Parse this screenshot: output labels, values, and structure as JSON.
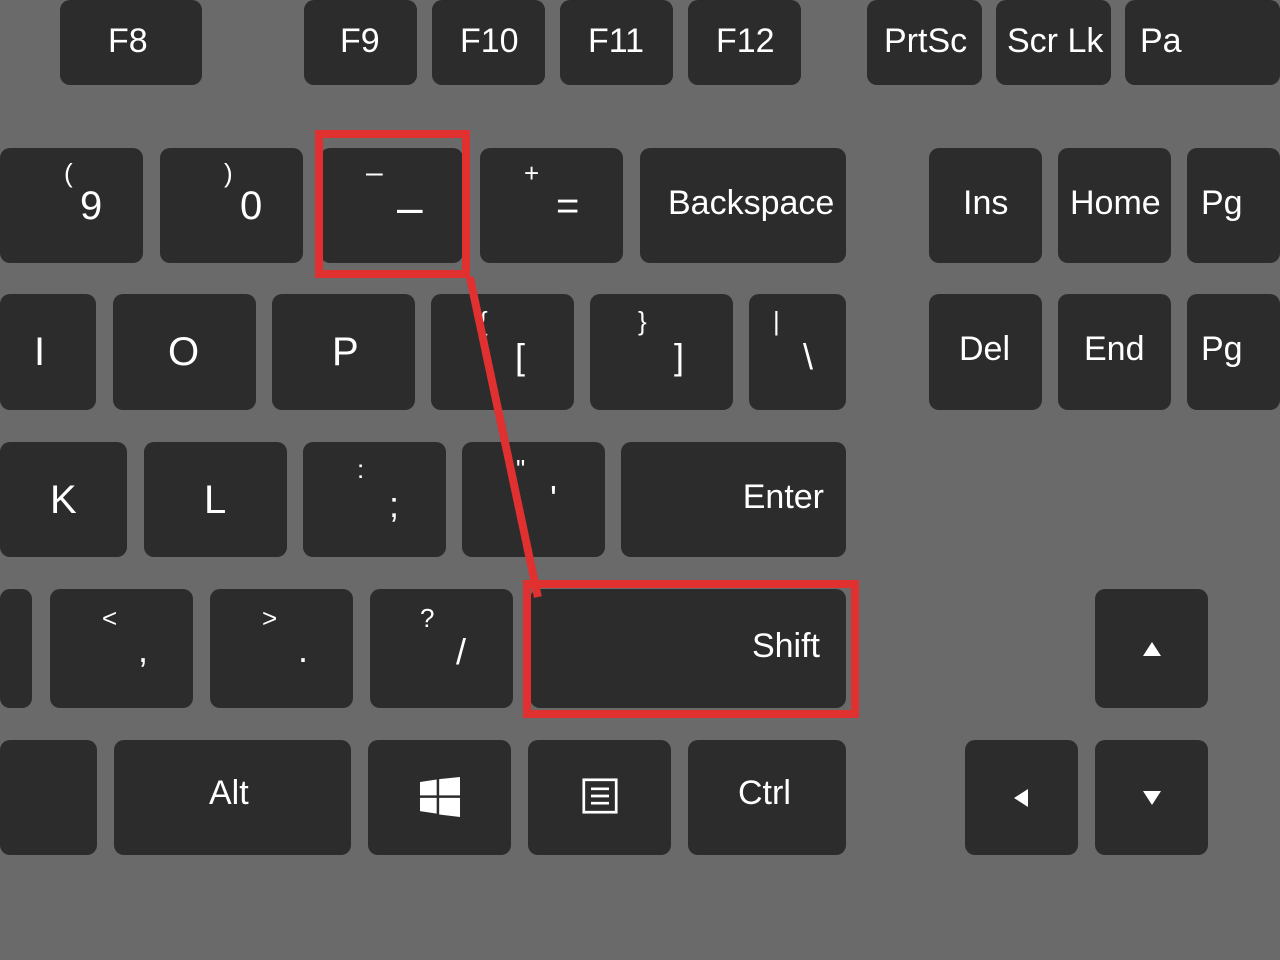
{
  "row_fn": {
    "f8": "F8",
    "f9": "F9",
    "f10": "F10",
    "f11": "F11",
    "f12": "F12",
    "prtsc": "PrtSc",
    "scrlk": "Scr Lk",
    "pa": "Pa"
  },
  "row_num": {
    "k9_upper": "(",
    "k9_lower": "9",
    "k0_upper": ")",
    "k0_lower": "0",
    "minus_upper": "–",
    "minus_lower": "–",
    "eq_upper": "+",
    "eq_lower": "=",
    "backspace": "Backspace",
    "ins": "Ins",
    "home": "Home",
    "pg": "Pg"
  },
  "row_qwer": {
    "i": "I",
    "o": "O",
    "p": "P",
    "lb_upper": "{",
    "lb_lower": "[",
    "rb_upper": "}",
    "rb_lower": "]",
    "bs_upper": "|",
    "bs_lower": "\\",
    "del": "Del",
    "end": "End",
    "pg": "Pg"
  },
  "row_asdf": {
    "k": "K",
    "l": "L",
    "semi_upper": ":",
    "semi_lower": ";",
    "quote_upper": "\"",
    "quote_lower": "'",
    "enter": "Enter"
  },
  "row_zxcv": {
    "m": "",
    "comma_upper": "<",
    "comma_lower": ",",
    "period_upper": ">",
    "period_lower": ".",
    "slash_upper": "?",
    "slash_lower": "/",
    "shift": "Shift"
  },
  "row_bottom": {
    "alt": "Alt",
    "ctrl": "Ctrl"
  }
}
